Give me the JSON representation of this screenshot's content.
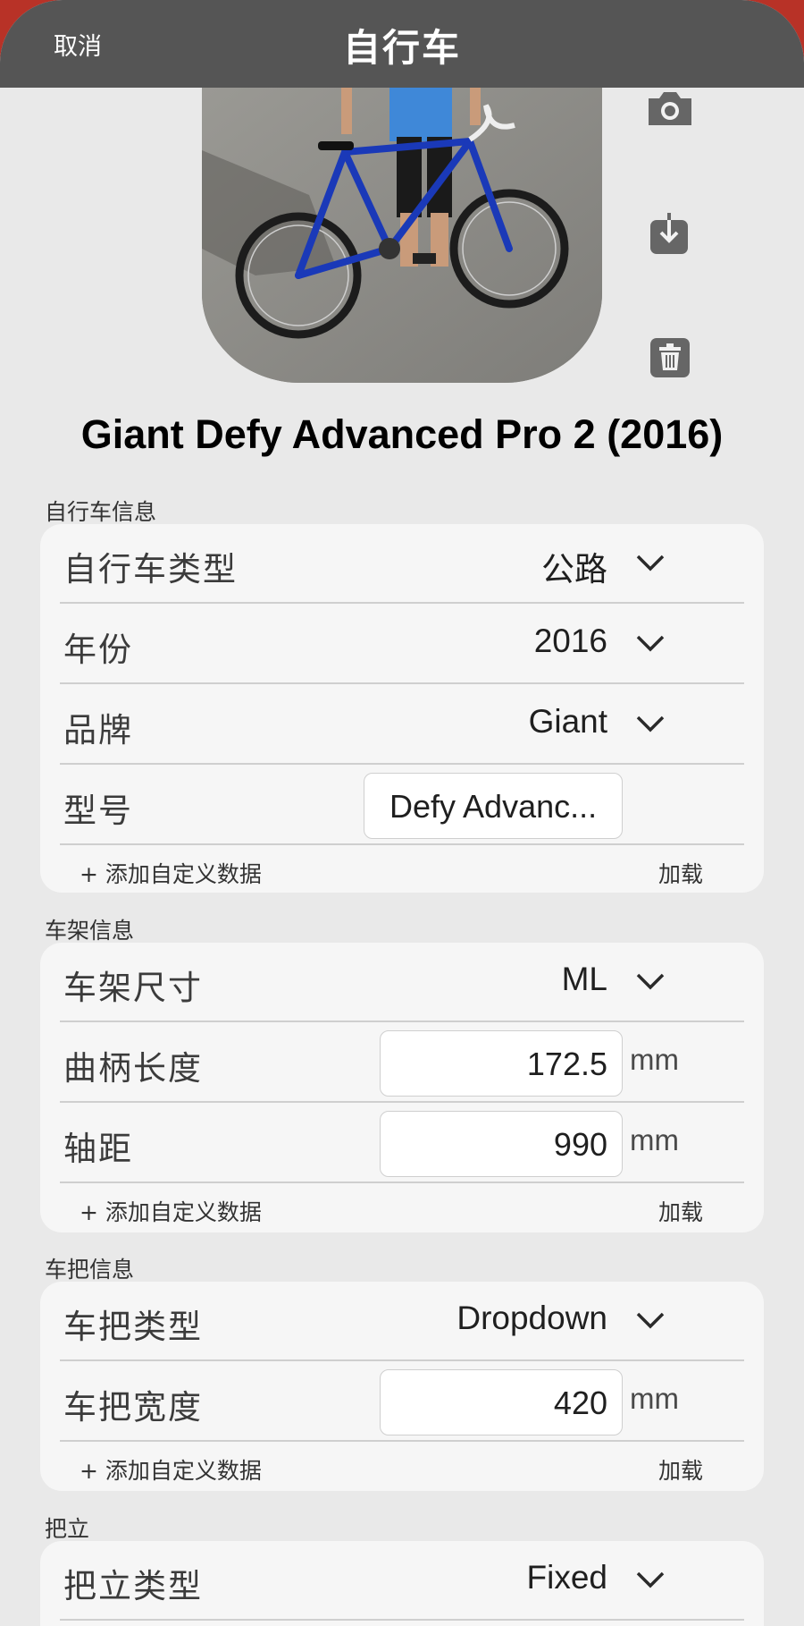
{
  "nav": {
    "cancel": "取消",
    "title": "自行车"
  },
  "photo_icons": [
    "camera-icon",
    "download-icon",
    "trash-icon"
  ],
  "bike_name": "Giant Defy Advanced Pro 2 (2016)",
  "sections": {
    "bike_info": {
      "header": "自行车信息",
      "type_label": "自行车类型",
      "type_value": "公路",
      "year_label": "年份",
      "year_value": "2016",
      "brand_label": "品牌",
      "brand_value": "Giant",
      "model_label": "型号",
      "model_value": "Defy Advanc...",
      "add": "+ 添加自定义数据",
      "load": "加载"
    },
    "frame_info": {
      "header": "车架信息",
      "size_label": "车架尺寸",
      "size_value": "ML",
      "crank_label": "曲柄长度",
      "crank_value": "172.5",
      "crank_unit": "mm",
      "wheelbase_label": "轴距",
      "wheelbase_value": "990",
      "wheelbase_unit": "mm",
      "add": "+ 添加自定义数据",
      "load": "加载"
    },
    "handlebar_info": {
      "header": "车把信息",
      "type_label": "车把类型",
      "type_value": "Dropdown",
      "width_label": "车把宽度",
      "width_value": "420",
      "width_unit": "mm",
      "add": "+ 添加自定义数据",
      "load": "加载"
    },
    "stem_info": {
      "header": "把立",
      "type_label": "把立类型",
      "type_value": "Fixed"
    }
  },
  "colors": {
    "navbar": "#555555",
    "background": "#e9e9e9",
    "card": "#f6f6f6",
    "accent_red": "#b83227"
  }
}
